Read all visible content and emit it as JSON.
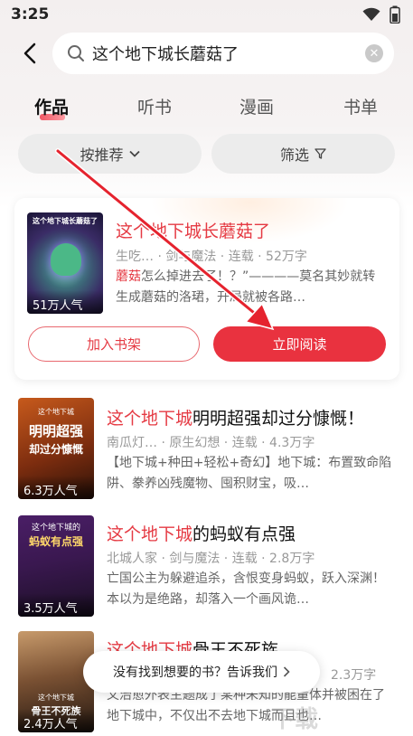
{
  "status_bar": {
    "time": "3:25"
  },
  "search": {
    "query": "这个地下城长蘑菇了"
  },
  "tabs": [
    {
      "label": "作品",
      "active": true
    },
    {
      "label": "听书",
      "active": false
    },
    {
      "label": "漫画",
      "active": false
    },
    {
      "label": "书单",
      "active": false
    }
  ],
  "filters": {
    "sort_label": "按推荐",
    "filter_label": "筛选"
  },
  "featured": {
    "cover_title": "这个地下城长蘑菇了",
    "readers": "51万人气",
    "title_hl": "这个地下城长蘑菇了",
    "meta": "生吃… · 剑与魔法 · 连载 · 52万字",
    "desc_hl": "蘑菇",
    "desc_rest": "怎么掉进去了！？”————莫名其妙就转生成蘑菇的洛珺，开局就被各路…",
    "shelf_button": "加入书架",
    "read_button": "立即阅读"
  },
  "books": [
    {
      "cover_lines": [
        "这个地下城",
        "明明超强",
        "却过分慷慨"
      ],
      "readers": "6.3万人气",
      "title_hl": "这个地下城",
      "title_rest": "明明超强却过分慷慨！",
      "meta": "南瓜灯… · 原生幻想 · 连载 · 4.3万字",
      "desc": "【地下城+种田+轻松+奇幻】地下城：布置致命陷阱、豢养凶残魔物、囤积财宝，吸…"
    },
    {
      "cover_lines": [
        "这个地下城的",
        "蚂蚁有点强"
      ],
      "readers": "3.5万人气",
      "title_hl": "这个地下城",
      "title_rest": "的蚂蚁有点强",
      "meta": "北城人家 · 剑与魔法 · 连载 · 2.8万字",
      "desc": "亡国公主为躲避追杀，含恨变身蚂蚁，跃入深渊！本以为是绝路，却落入一个画风诡…"
    },
    {
      "cover_lines": [
        "这个地下城",
        "骨王不死族"
      ],
      "readers": "2.4万人气",
      "title_hl": "这个地下城",
      "title_rest": "骨王不死族",
      "meta": "2.3万字",
      "desc": "文治愈外表主题成了某种未知的能量体并被困在了地下城中，不仅出不去地下城而且也…"
    }
  ],
  "feedback": {
    "label": "没有找到想要的书？告诉我们"
  },
  "watermark": "下载"
}
